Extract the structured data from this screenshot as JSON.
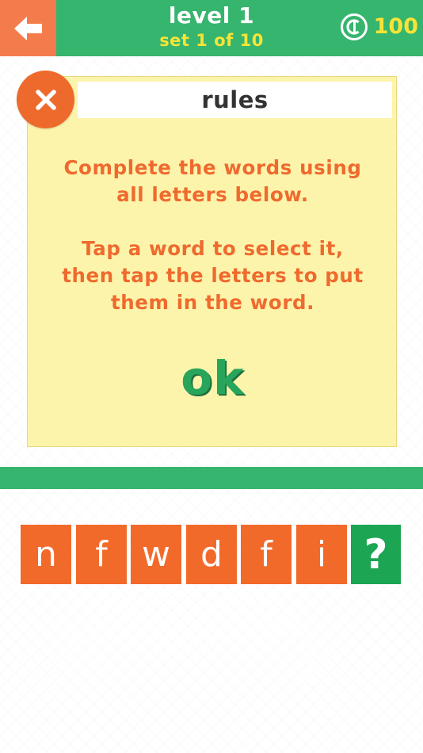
{
  "header": {
    "title": "level 1",
    "subtitle": "set 1 of 10",
    "coins": "100",
    "back_icon": "arrow-left-icon",
    "coin_icon": "coin-icon",
    "colors": {
      "bar": "#36b56e",
      "back": "#f47c4c",
      "accent": "#f7e436"
    }
  },
  "rules_dialog": {
    "title": "rules",
    "paragraph_1": "Complete the words using\nall letters below.",
    "paragraph_2": "Tap a word to select it,\nthen tap the letters to put\nthem in the word.",
    "ok_label": "ok",
    "close_icon": "close-icon",
    "colors": {
      "background": "#fdf4ac",
      "text": "#ef6a2e",
      "ok": "#27a55a",
      "close": "#ee6a2c"
    }
  },
  "letters": [
    "n",
    "f",
    "w",
    "d",
    "f",
    "i"
  ],
  "hint_label": "?",
  "colors": {
    "tile": "#f26a2a",
    "hint": "#1ca552"
  }
}
